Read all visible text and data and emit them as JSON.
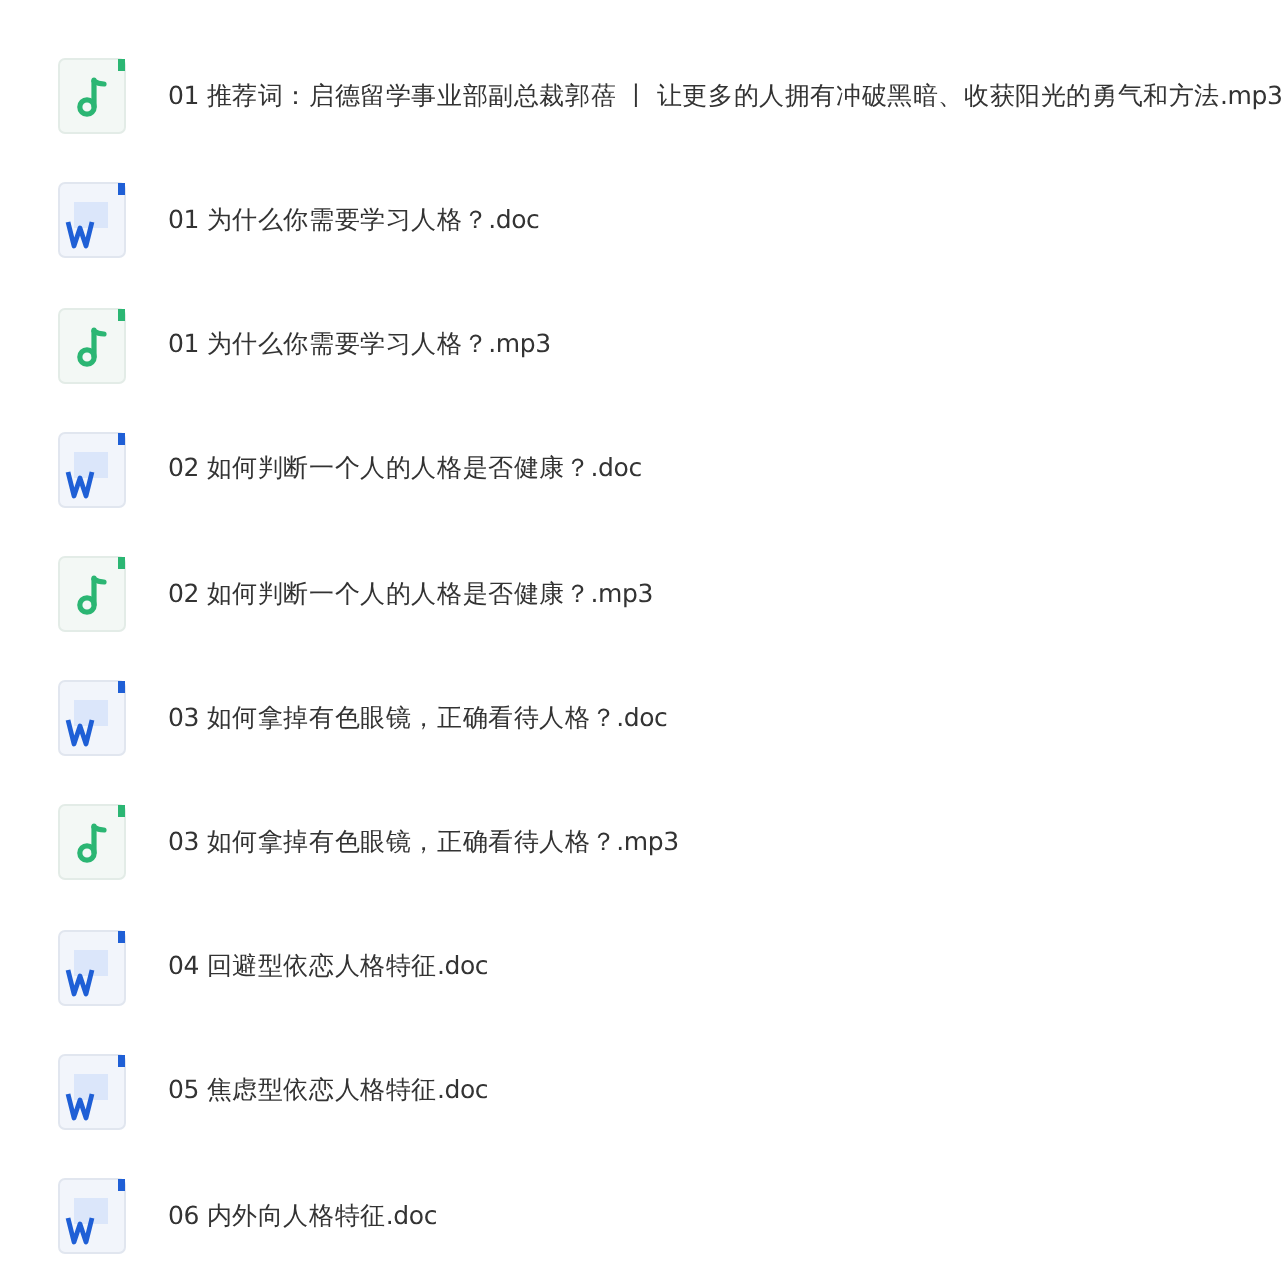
{
  "files": [
    {
      "kind": "audio",
      "name": "01 推荐词：启德留学事业部副总裁郭蓓 丨 让更多的人拥有冲破黑暗、收获阳光的勇气和方法.mp3"
    },
    {
      "kind": "doc",
      "name": "01 为什么你需要学习人格？.doc"
    },
    {
      "kind": "audio",
      "name": "01 为什么你需要学习人格？.mp3"
    },
    {
      "kind": "doc",
      "name": "02 如何判断一个人的人格是否健康？.doc"
    },
    {
      "kind": "audio",
      "name": "02 如何判断一个人的人格是否健康？.mp3"
    },
    {
      "kind": "doc",
      "name": "03 如何拿掉有色眼镜，正确看待人格？.doc"
    },
    {
      "kind": "audio",
      "name": "03 如何拿掉有色眼镜，正确看待人格？.mp3"
    },
    {
      "kind": "doc",
      "name": "04 回避型依恋人格特征.doc"
    },
    {
      "kind": "doc",
      "name": "05 焦虑型依恋人格特征.doc"
    },
    {
      "kind": "doc",
      "name": "06 内外向人格特征.doc"
    }
  ]
}
